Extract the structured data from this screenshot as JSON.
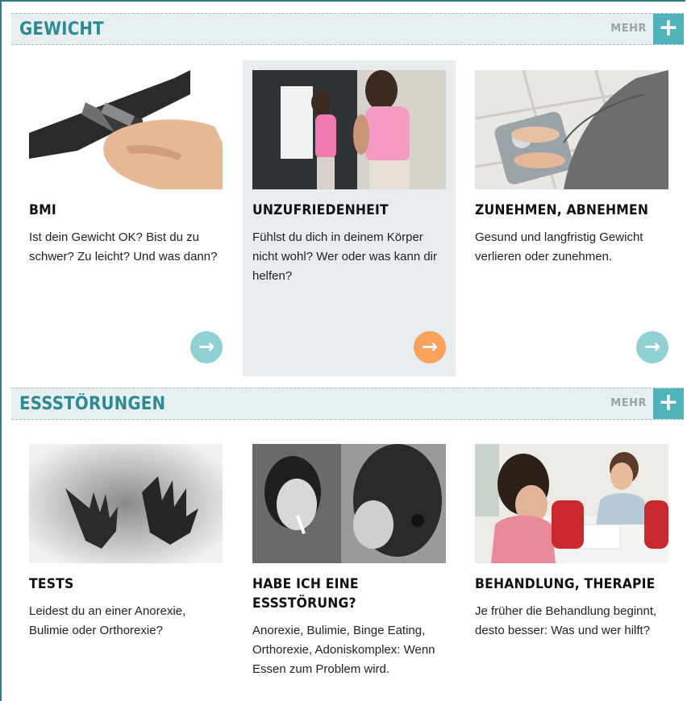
{
  "sections": [
    {
      "title": "GEWICHT",
      "more_label": "MEHR",
      "plus": "+",
      "cards": [
        {
          "title": "BMI",
          "text": "Ist dein Gewicht OK? Bist du zu schwer? Zu leicht? Und was dann?",
          "image": "belt-photo",
          "arrow": "→"
        },
        {
          "title": "UNZUFRIEDENHEIT",
          "text": "Fühlst du dich in deinem Körper nicht wohl? Wer oder was kann dir helfen?",
          "image": "mirror-photo",
          "arrow": "→"
        },
        {
          "title": "ZUNEHMEN, ABNEHMEN",
          "text": "Gesund und langfristig Gewicht verlieren oder zunehmen.",
          "image": "scale-photo",
          "arrow": "→"
        }
      ]
    },
    {
      "title": "ESSSTÖRUNGEN",
      "more_label": "MEHR",
      "plus": "+",
      "cards": [
        {
          "title": "TESTS",
          "text": "Leidest du an einer Anorexie, Bulimie oder Orthorexie?",
          "image": "hands-photo"
        },
        {
          "title": "HABE ICH EINE ESSSTÖRUNG?",
          "text": "Anorexie, Bulimie, Binge Eating, Orthorexie, Adoniskomplex: Wenn Essen zum Problem wird.",
          "image": "girls-mirror-photo"
        },
        {
          "title": "BEHANDLUNG, THERAPIE",
          "text": "Je früher die Behandlung beginnt, desto besser: Was und wer hilft?",
          "image": "therapy-photo"
        }
      ]
    }
  ],
  "colors": {
    "accent": "#4fb3b9",
    "title": "#2e8a92",
    "header_bg": "#e8eff0",
    "highlight_bg": "#e7edee",
    "arrow_teal": "#8fd0d2",
    "arrow_orange": "#f7a15a"
  }
}
